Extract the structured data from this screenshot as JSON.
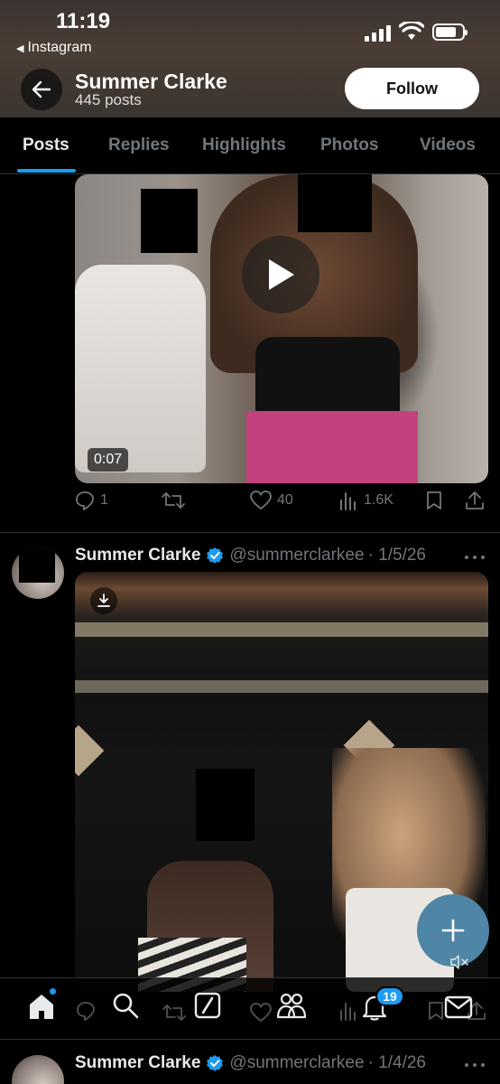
{
  "status_bar": {
    "time": "11:19",
    "back_app": "Instagram"
  },
  "profile": {
    "name": "Summer Clarke",
    "posts_count": "445 posts",
    "follow_label": "Follow"
  },
  "tabs": [
    {
      "label": "Posts",
      "active": true
    },
    {
      "label": "Replies",
      "active": false
    },
    {
      "label": "Highlights",
      "active": false
    },
    {
      "label": "Photos",
      "active": false
    },
    {
      "label": "Videos",
      "active": false
    }
  ],
  "post1": {
    "video_duration": "0:07",
    "replies": "1",
    "reposts": "",
    "likes": "40",
    "views": "1.6K"
  },
  "post2": {
    "author": "Summer Clarke",
    "handle": "@summerclarkee",
    "date": "· 1/5/26"
  },
  "post3": {
    "author": "Summer Clarke",
    "handle": "@summerclarkee",
    "date": "· 1/4/26"
  },
  "bottom_nav": {
    "notifications_badge": "19"
  },
  "colors": {
    "accent": "#1d9bf0",
    "background": "#000000",
    "muted": "#71767b",
    "fab": "#4f86a6"
  }
}
